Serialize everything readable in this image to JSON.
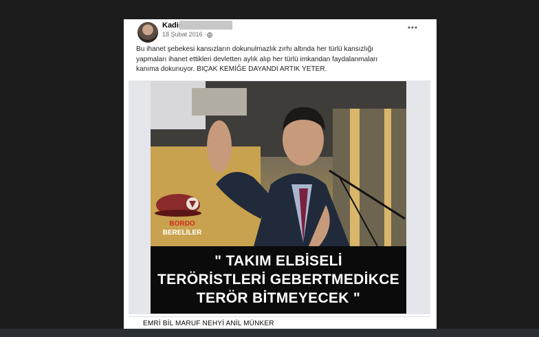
{
  "post": {
    "author_name": "Kadir",
    "date": "18 Şubat 2016 ·",
    "text_lines": [
      "Bu ihanet şebekesi kansızların dokunulmazlık zırhı altında her türlü kansızlığı",
      "yapmaları ihanet ettikleri devletten aylık alıp her türlü imkandan faydalanmaları",
      "kanıma dokunuyor. BIÇAK KEMİĞE DAYANDI ARTIK YETER."
    ],
    "image_overlay_lines": [
      "\" TAKIM ELBİSELİ",
      "TERÖRİSTLERİ GEBERTMEDİKCE",
      "TERÖR BİTMEYECEK \""
    ],
    "logo_text": [
      "BORDO",
      "BERELİLER"
    ],
    "link_title": "EMRİ BİL MARUF NEHYİ ANİL MÜNKER"
  },
  "icons": {
    "more": "more-options-icon",
    "privacy": "globe-icon"
  },
  "colors": {
    "background": "#1c1c1c",
    "card": "#ffffff",
    "text": "#1c1e21",
    "meta": "#65676b",
    "beret": "#8b2a2a"
  }
}
